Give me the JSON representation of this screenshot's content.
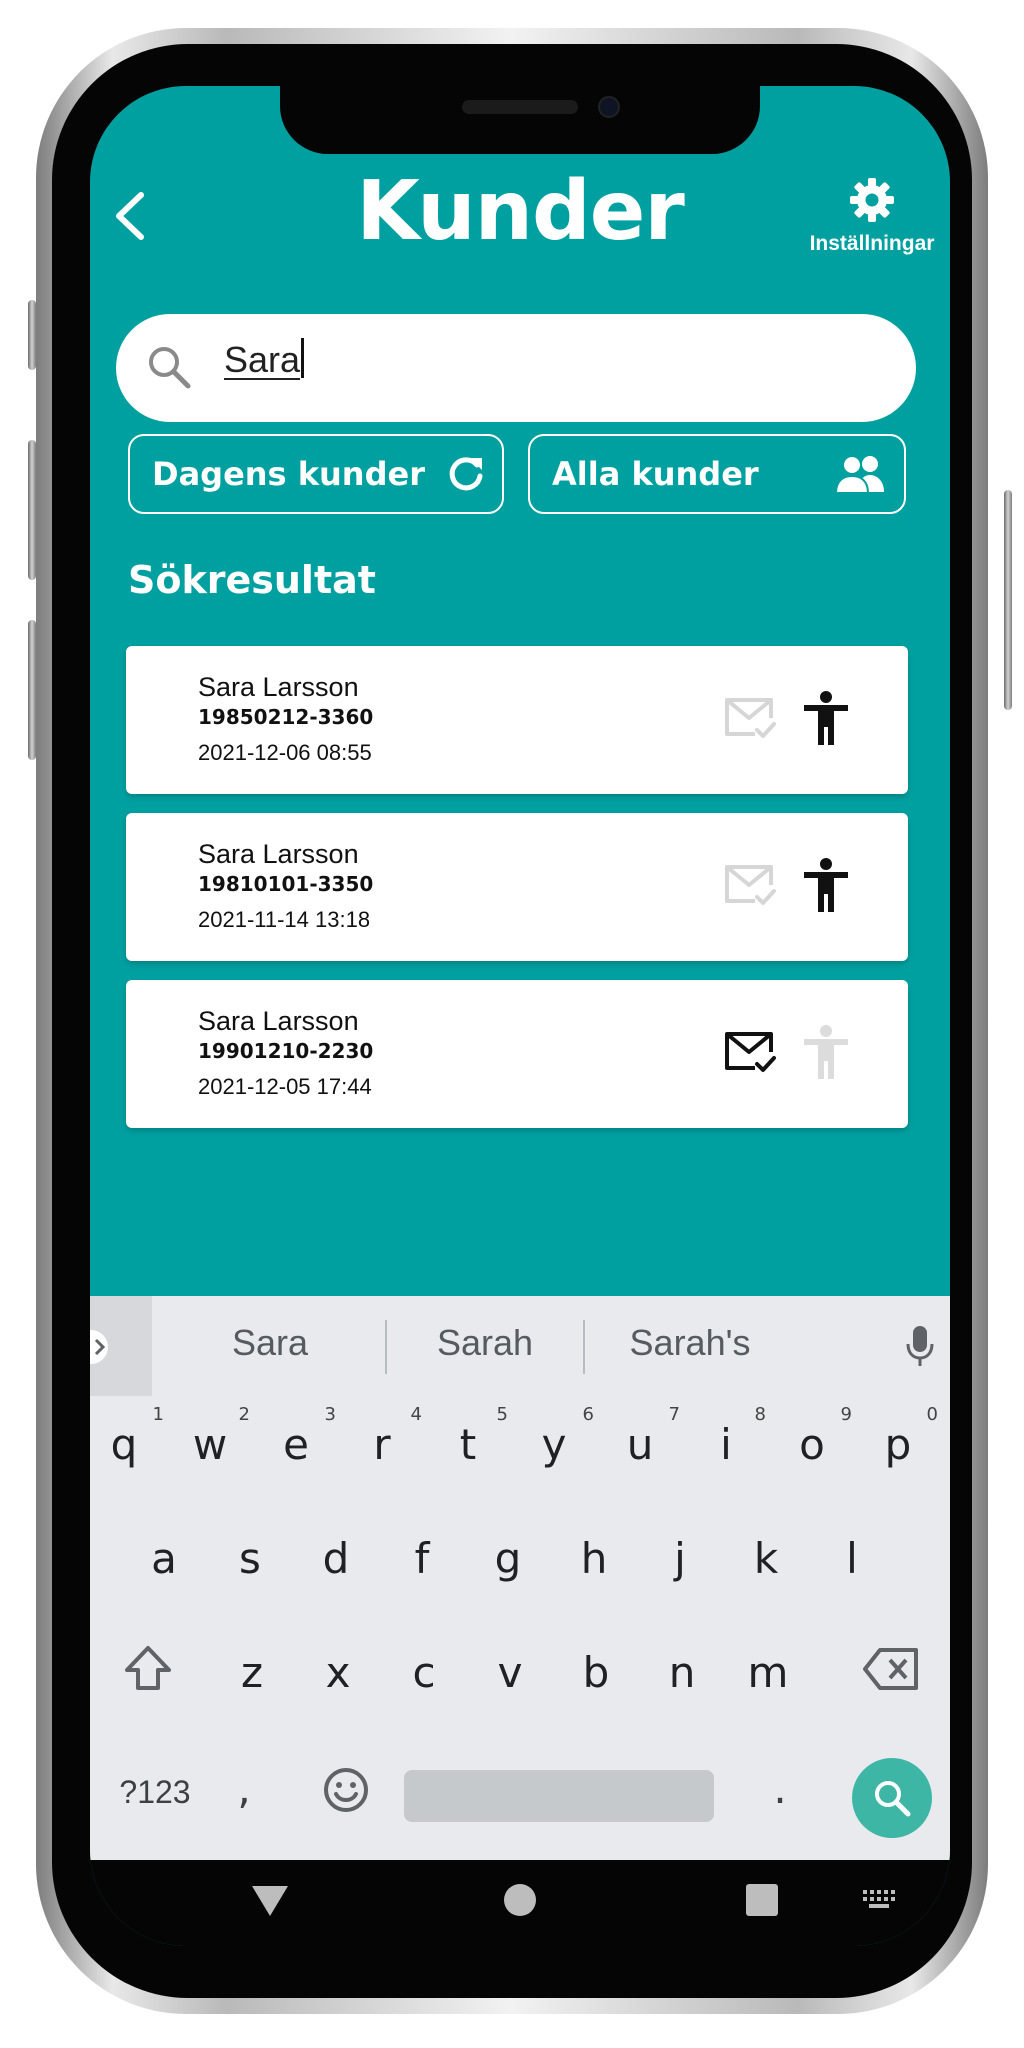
{
  "app": {
    "title": "Kunder",
    "settings_label": "Inställningar"
  },
  "search": {
    "value": "Sara"
  },
  "filters": {
    "today_label": "Dagens kunder",
    "all_label": "Alla kunder"
  },
  "results": {
    "heading": "Sökresultat",
    "items": [
      {
        "name": "Sara Larsson",
        "id": "19850212-3360",
        "timestamp": "2021-12-06 08:55",
        "mail_active": false,
        "person_active": true
      },
      {
        "name": "Sara Larsson",
        "id": "19810101-3350",
        "timestamp": "2021-11-14 13:18",
        "mail_active": false,
        "person_active": true
      },
      {
        "name": "Sara Larsson",
        "id": "19901210-2230",
        "timestamp": "2021-12-05 17:44",
        "mail_active": true,
        "person_active": false
      }
    ]
  },
  "keyboard": {
    "suggestions": [
      "Sara",
      "Sarah",
      "Sarah's"
    ],
    "row1": [
      "q",
      "w",
      "e",
      "r",
      "t",
      "y",
      "u",
      "i",
      "o",
      "p"
    ],
    "row1_hints": [
      "1",
      "2",
      "3",
      "4",
      "5",
      "6",
      "7",
      "8",
      "9",
      "0"
    ],
    "row2": [
      "a",
      "s",
      "d",
      "f",
      "g",
      "h",
      "j",
      "k",
      "l"
    ],
    "row3": [
      "z",
      "x",
      "c",
      "v",
      "b",
      "n",
      "m"
    ],
    "symbols_label": "?123",
    "comma_label": ",",
    "period_label": "."
  },
  "colors": {
    "accent": "#00a0a0",
    "keyboard_bg": "#e8eaed",
    "search_key": "#3db6a6",
    "inactive_icon": "#d6d6d6"
  },
  "icons": {
    "back": "chevron-left-icon",
    "settings": "gear-icon",
    "search": "search-icon",
    "refresh": "refresh-icon",
    "group": "users-icon",
    "mail": "mail-check-icon",
    "person": "person-icon",
    "mic": "mic-icon",
    "shift": "shift-icon",
    "backspace": "backspace-icon",
    "emoji": "emoji-icon"
  }
}
